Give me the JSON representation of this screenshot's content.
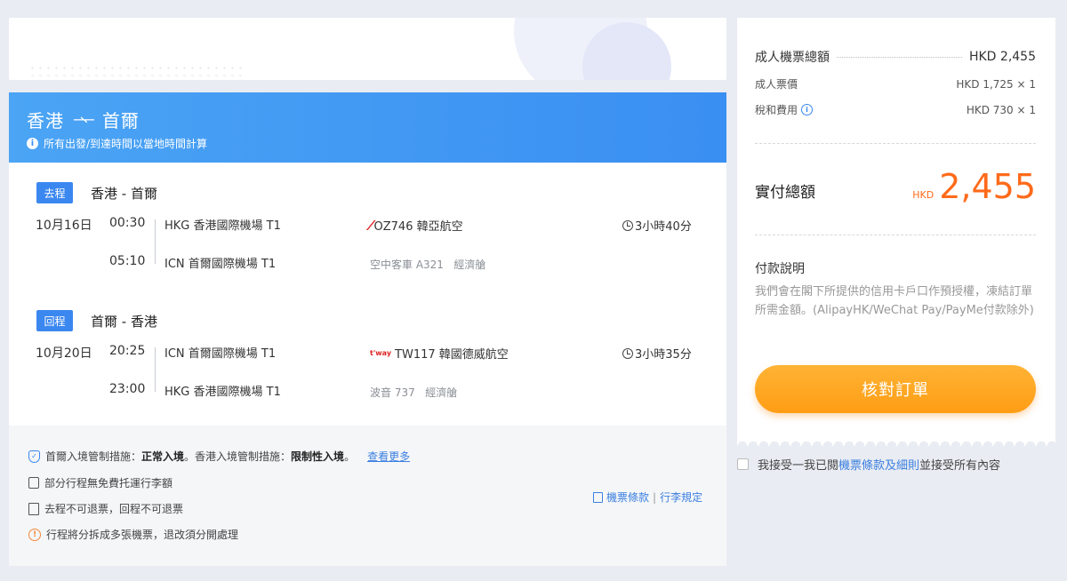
{
  "banner": {
    "origin": "香港",
    "arrows": "⇀↽",
    "destination": "首爾",
    "notice": "所有出發/到達時間以當地時間計算"
  },
  "outbound": {
    "tag": "去程",
    "route": "香港 - 首爾",
    "date": "10月16日",
    "dep_time": "00:30",
    "dep_airport": "HKG 香港國際機場 T1",
    "arr_time": "05:10",
    "arr_airport": "ICN 首爾國際機場 T1",
    "flight": "OZ746 韓亞航空",
    "aircraft": "空中客車 A321",
    "cabin": "經濟艙",
    "duration": "3小時40分"
  },
  "return": {
    "tag": "回程",
    "route": "首爾 - 香港",
    "date": "10月20日",
    "dep_time": "20:25",
    "dep_airport": "ICN 首爾國際機場 T1",
    "arr_time": "23:00",
    "arr_airport": "HKG 香港國際機場 T1",
    "flight": "TW117 韓國德威航空",
    "aircraft": "波音 737",
    "cabin": "經濟艙",
    "duration": "3小時35分"
  },
  "notes": {
    "entry_prefix": "首爾入境管制措施：",
    "entry_seoul": "正常入境",
    "entry_mid": "。香港入境管制措施：",
    "entry_hk": "限制性入境",
    "entry_suffix": "。",
    "see_more": "查看更多",
    "baggage": "部分行程無免費托運行李額",
    "refund": "去程不可退票，回程不可退票",
    "split": "行程將分拆成多張機票，退改須分開處理",
    "ticket_terms": "機票條款",
    "baggage_rules": "行李規定",
    "sep": "|"
  },
  "price": {
    "adult_total_label": "成人機票總額",
    "adult_total": "HKD 2,455",
    "fare_label": "成人票價",
    "fare": "HKD 1,725 × 1",
    "tax_label": "稅和費用",
    "tax": "HKD 730 × 1",
    "pay_label": "實付總額",
    "pay_currency": "HKD",
    "pay_amount": "2,455",
    "payment_title": "付款說明",
    "payment_desc": "我們會在閣下所提供的信用卡戶口作預授權，凍結訂單所需金額。(AlipayHK/WeChat Pay/PayMe付款除外)",
    "confirm": "核對訂單"
  },
  "agree": {
    "prefix": "我接受一我已閱",
    "link": "機票條款及細則",
    "suffix": "並接受所有內容"
  },
  "colors": {
    "accent": "#3b87f0",
    "price": "#ff6a1a",
    "button": "#ffa41f"
  }
}
